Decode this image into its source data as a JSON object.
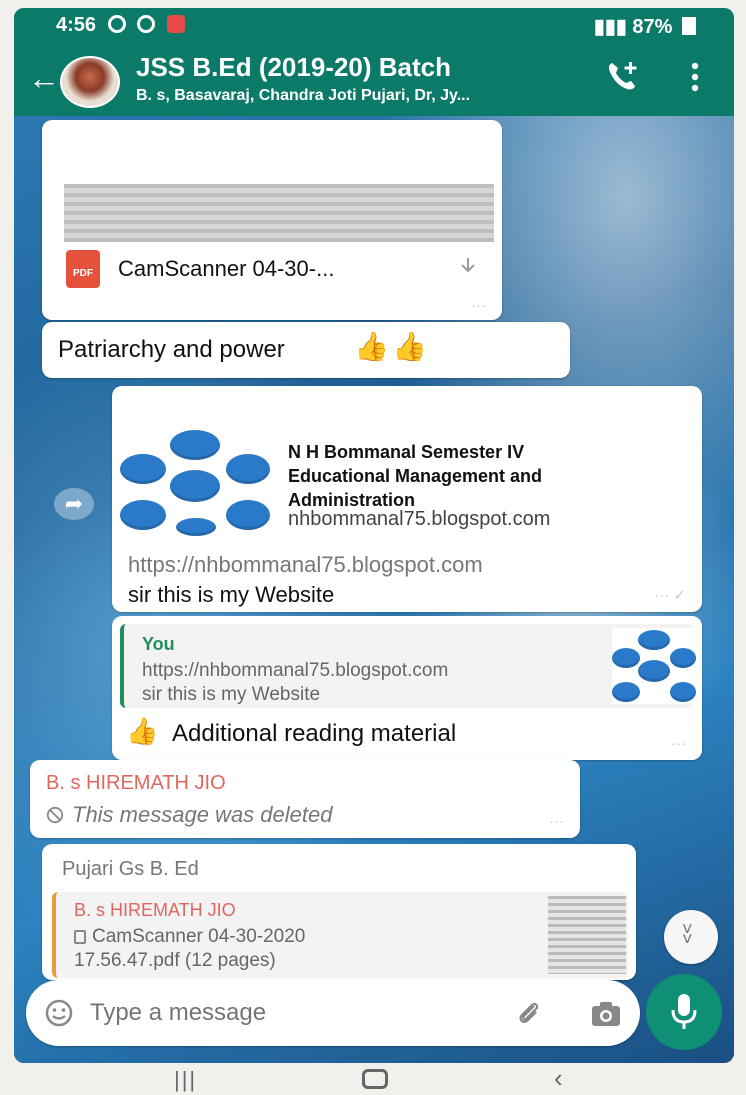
{
  "status_bar": {
    "time": "4:56",
    "right": "87%"
  },
  "header": {
    "title": "JSS B.Ed (2019-20) Batch",
    "subtitle": "B. s, Basavaraj, Chandra Joti Pujari, Dr, Jy..."
  },
  "messages": {
    "doc1": {
      "name": "CamScanner 04-30-..."
    },
    "text1": {
      "text": "Patriarchy and power"
    },
    "link1": {
      "title_line1": "N H Bommanal Semester IV",
      "title_line2": "Educational Management and",
      "title_line3": "Administration",
      "domain": "nhbommanal75.blogspot.com",
      "url": "https://nhbommanal75.blogspot.com",
      "body": "sir this is my Website"
    },
    "reply1": {
      "quote_author": "You",
      "quote_line1": "https://nhbommanal75.blogspot.com",
      "quote_line2": "sir this is my Website",
      "body": "Additional reading material"
    },
    "deleted1": {
      "sender": "B. s HIREMATH JIO",
      "text": "This message was deleted"
    },
    "reply2": {
      "sender": "Pujari Gs B. Ed",
      "quote_author": "B. s HIREMATH JIO",
      "quote_line1": "CamScanner 04-30-2020",
      "quote_line2": "17.56.47.pdf (12 pages)"
    }
  },
  "input": {
    "placeholder": "Type a message"
  },
  "colors": {
    "header": "#0c7a68",
    "accent": "#0f8f74",
    "sender": "#e0665e"
  }
}
